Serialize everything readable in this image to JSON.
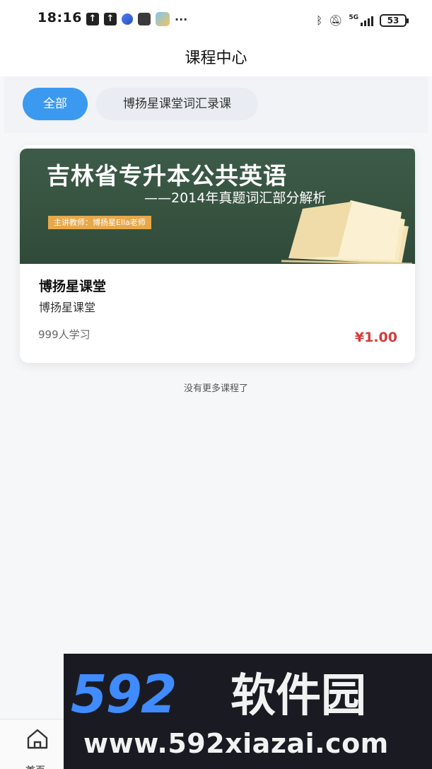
{
  "status_bar": {
    "time": "18:16",
    "more": "···",
    "battery": "53",
    "network": "5G",
    "icons": [
      "upload-icon",
      "upload-icon",
      "app-icon",
      "notification-icon",
      "weather-icon",
      "bluetooth-icon",
      "mute-icon",
      "signal-icon",
      "battery-icon"
    ]
  },
  "header": {
    "title": "课程中心"
  },
  "tabs": [
    {
      "label": "全部",
      "active": true
    },
    {
      "label": "博扬星课堂词汇录课",
      "active": false
    }
  ],
  "course": {
    "banner": {
      "title": "吉林省专升本公共英语",
      "subtitle": "——2014年真题词汇部分解析",
      "teacher": "主讲教师：博扬星Ella老师",
      "background_color": "#3d5b49"
    },
    "name": "博扬星课堂",
    "provider": "博扬星课堂",
    "learners": "999人学习",
    "price": "¥1.00",
    "price_color": "#d43b3b"
  },
  "list_end_text": "没有更多课程了",
  "bottom_nav": {
    "home_label": "首页"
  },
  "watermark": {
    "logo_number": "592",
    "logo_text": "软件园",
    "url": "www.592xiazai.com"
  },
  "colors": {
    "accent": "#3b9af0",
    "background": "#f6f7f9"
  }
}
